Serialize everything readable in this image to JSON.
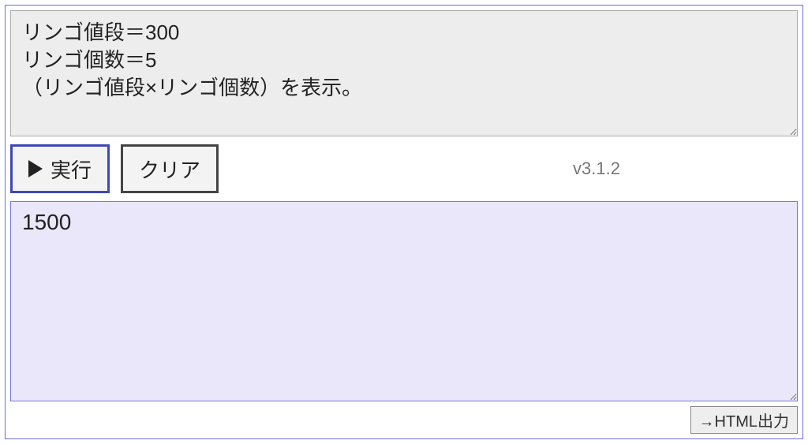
{
  "input": {
    "code": "リンゴ値段＝300\nリンゴ個数＝5\n（リンゴ値段×リンゴ個数）を表示。"
  },
  "toolbar": {
    "run_label": "実行",
    "clear_label": "クリア",
    "version": "v3.1.2"
  },
  "output": {
    "text": "1500"
  },
  "footer": {
    "html_export_label": "→HTML出力"
  }
}
